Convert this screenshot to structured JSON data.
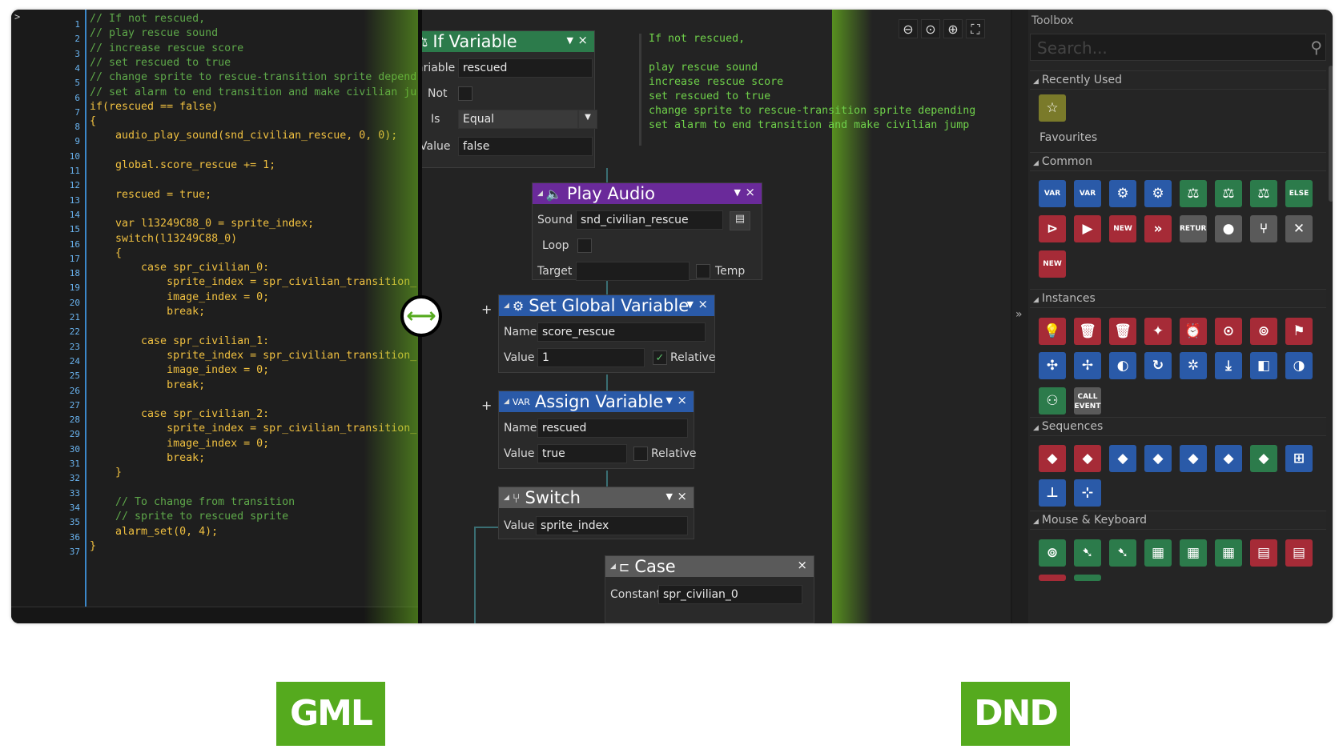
{
  "code_editor": {
    "line_numbers": [
      "1",
      "2",
      "3",
      "4",
      "5",
      "6",
      "7",
      "8",
      "9",
      "10",
      "11",
      "12",
      "13",
      "14",
      "15",
      "16",
      "17",
      "18",
      "19",
      "20",
      "21",
      "22",
      "23",
      "24",
      "25",
      "26",
      "27",
      "28",
      "29",
      "30",
      "31",
      "32",
      "33",
      "34",
      "35",
      "36",
      "37"
    ],
    "lines": [
      {
        "text": "// If not rescued,",
        "color": "#5ea84a"
      },
      {
        "text": "// play rescue sound",
        "color": "#5ea84a"
      },
      {
        "text": "// increase rescue score",
        "color": "#5ea84a"
      },
      {
        "text": "// set rescued to true",
        "color": "#5ea84a"
      },
      {
        "text": "// change sprite to rescue-transition sprite depend",
        "color": "#5ea84a"
      },
      {
        "text": "// set alarm to end transition and make civilian ju",
        "color": "#5ea84a"
      },
      {
        "text": "if(rescued == false)",
        "color": "#f0c040"
      },
      {
        "text": "{",
        "color": "#f0c040"
      },
      {
        "text": "    audio_play_sound(snd_civilian_rescue, 0, 0);",
        "color": "#f0c040"
      },
      {
        "text": "",
        "color": "#f0c040"
      },
      {
        "text": "    global.score_rescue += 1;",
        "color": "#f0c040"
      },
      {
        "text": "",
        "color": "#f0c040"
      },
      {
        "text": "    rescued = true;",
        "color": "#f0c040"
      },
      {
        "text": "",
        "color": "#f0c040"
      },
      {
        "text": "    var l13249C88_0 = sprite_index;",
        "color": "#f0c040"
      },
      {
        "text": "    switch(l13249C88_0)",
        "color": "#f0c040"
      },
      {
        "text": "    {",
        "color": "#f0c040"
      },
      {
        "text": "        case spr_civilian_0:",
        "color": "#f0c040"
      },
      {
        "text": "            sprite_index = spr_civilian_transition_",
        "color": "#f0c040"
      },
      {
        "text": "            image_index = 0;",
        "color": "#f0c040"
      },
      {
        "text": "            break;",
        "color": "#f0c040"
      },
      {
        "text": "",
        "color": "#f0c040"
      },
      {
        "text": "        case spr_civilian_1:",
        "color": "#f0c040"
      },
      {
        "text": "            sprite_index = spr_civilian_transition_",
        "color": "#f0c040"
      },
      {
        "text": "            image_index = 0;",
        "color": "#f0c040"
      },
      {
        "text": "            break;",
        "color": "#f0c040"
      },
      {
        "text": "",
        "color": "#f0c040"
      },
      {
        "text": "        case spr_civilian_2:",
        "color": "#f0c040"
      },
      {
        "text": "            sprite_index = spr_civilian_transition_",
        "color": "#f0c040"
      },
      {
        "text": "            image_index = 0;",
        "color": "#f0c040"
      },
      {
        "text": "            break;",
        "color": "#f0c040"
      },
      {
        "text": "    }",
        "color": "#f0c040"
      },
      {
        "text": "",
        "color": "#f0c040"
      },
      {
        "text": "    // To change from transition",
        "color": "#5ea84a"
      },
      {
        "text": "    // sprite to rescued sprite",
        "color": "#5ea84a"
      },
      {
        "text": "    alarm_set(0, 4);",
        "color": "#f0c040"
      },
      {
        "text": "}",
        "color": "#f0c040"
      }
    ]
  },
  "split_handle": {
    "icon": "⟷"
  },
  "dnd": {
    "if_variable": {
      "title": "If Variable",
      "variable_label": "ariable",
      "variable_value": "rescued",
      "not_label": "Not",
      "is_label": "Is",
      "is_value": "Equal",
      "value_label": "Value",
      "value_value": "false"
    },
    "comment": "If not rescued,\n\nplay rescue sound\nincrease rescue score\nset rescued to true\nchange sprite to rescue-transition sprite depending\nset alarm to end transition and make civilian jump",
    "play_audio": {
      "title": "Play Audio",
      "sound_label": "Sound",
      "sound_value": "snd_civilian_rescue",
      "loop_label": "Loop",
      "target_label": "Target",
      "target_value": "",
      "temp_label": "Temp"
    },
    "set_global": {
      "title": "Set Global Variable",
      "name_label": "Name",
      "name_value": "score_rescue",
      "value_label": "Value",
      "value_value": "1",
      "relative_label": "Relative"
    },
    "assign_variable": {
      "title": "Assign Variable",
      "name_label": "Name",
      "name_value": "rescued",
      "value_label": "Value",
      "value_value": "true",
      "relative_label": "Relative"
    },
    "switch": {
      "title": "Switch",
      "value_label": "Value",
      "value_value": "sprite_index"
    },
    "case": {
      "title": "Case",
      "constant_label": "Constant",
      "constant_value": "spr_civilian_0"
    },
    "plus": "+"
  },
  "toolbox": {
    "title": "Toolbox",
    "search_placeholder": "Search...",
    "sections": {
      "recently_used": "Recently Used",
      "favourites": "Favourites",
      "common": "Common",
      "instances": "Instances",
      "sequences": "Sequences",
      "mouse_keyboard": "Mouse & Keyboard"
    },
    "tile_labels": {
      "var": "VAR",
      "else": "ELSE",
      "new": "NEW",
      "return": "RETURN",
      "call_event": "CALL EVENT"
    }
  },
  "badges": {
    "gml": "GML",
    "dnd": "DND"
  },
  "colors": {
    "accent_green": "#55aa1e",
    "dnd_blue": "#2a5aa8",
    "dnd_purple": "#6a2a9a",
    "dnd_green": "#2c7b4b",
    "dnd_red": "#a62b37"
  }
}
